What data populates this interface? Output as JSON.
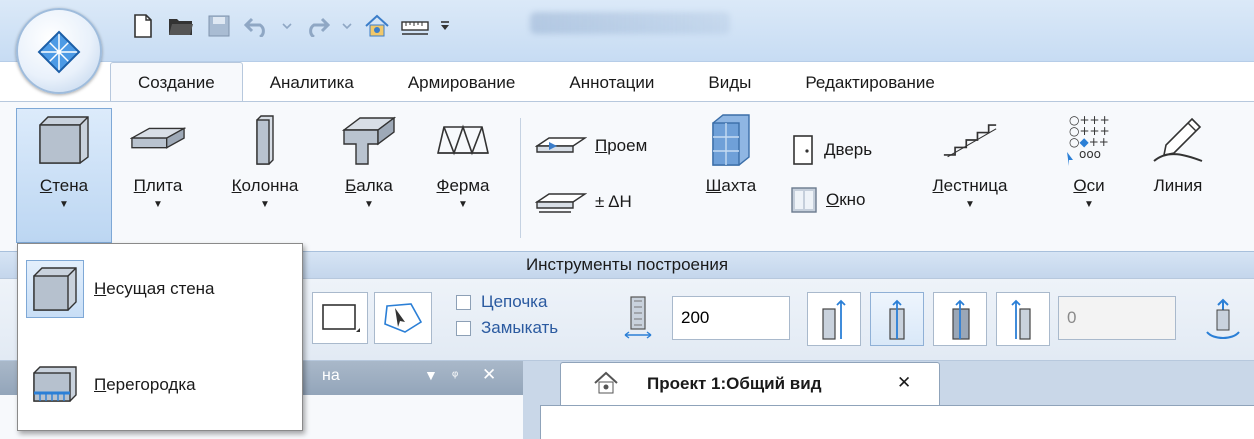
{
  "quick_access": {
    "icons": [
      "new-file-icon",
      "open-folder-icon",
      "save-icon",
      "undo-icon",
      "redo-icon",
      "home-view-icon",
      "measure-icon",
      "customize-icon"
    ]
  },
  "tabs": [
    {
      "label": "Создание",
      "active": true
    },
    {
      "label": "Аналитика"
    },
    {
      "label": "Армирование"
    },
    {
      "label": "Аннотации"
    },
    {
      "label": "Виды"
    },
    {
      "label": "Редактирование"
    }
  ],
  "ribbon": {
    "large_buttons": [
      {
        "label": "Стена",
        "ul": "С",
        "rest": "тена",
        "dropdown": true
      },
      {
        "label": "Плита",
        "ul": "П",
        "rest": "лита",
        "dropdown": true
      },
      {
        "label": "Колонна",
        "ul": "К",
        "rest": "олонна",
        "dropdown": true
      },
      {
        "label": "Балка",
        "ul": "Б",
        "rest": "алка",
        "dropdown": true
      },
      {
        "label": "Ферма",
        "ul": "Ф",
        "rest": "ерма",
        "dropdown": true
      },
      {
        "label": "Шахта",
        "ul": "Ш",
        "rest": "ахта",
        "dropdown": false
      },
      {
        "label": "Лестница",
        "ul": "Л",
        "rest": "естница",
        "dropdown": true
      },
      {
        "label": "Оси",
        "ul": "О",
        "rest": "си",
        "dropdown": true
      },
      {
        "label": "Линия",
        "ul": "",
        "rest": "Линия",
        "dropdown": false
      }
    ],
    "opening": {
      "ul": "П",
      "rest": "роем"
    },
    "delta_h": "± ΔH",
    "door": {
      "ul": "Д",
      "rest": "верь"
    },
    "window": {
      "ul": "О",
      "rest": "кно"
    },
    "group_caption": "Инструменты построения"
  },
  "dropdown": {
    "items": [
      {
        "ul": "Н",
        "rest": "есущая стена"
      },
      {
        "ul": "П",
        "rest": "ерегородка"
      }
    ]
  },
  "propbar": {
    "chain_label": "Цепочка",
    "close_label": "Замыкать",
    "thickness_value": "200",
    "offset_value": "0"
  },
  "left_panel": {
    "title_fragment": "на"
  },
  "document": {
    "tab_title": "Проект 1:Общий вид",
    "close_glyph": "✕"
  }
}
